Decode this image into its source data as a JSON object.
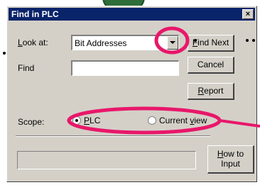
{
  "dialog": {
    "title": "Find in PLC",
    "close_glyph": "×"
  },
  "look_at": {
    "label_u": "L",
    "label_rest": "ook at:",
    "value": "Bit Addresses"
  },
  "find": {
    "label": "Find",
    "value": ""
  },
  "buttons": {
    "find_next_u": "F",
    "find_next_rest": "ind Next",
    "cancel": "Cancel",
    "report_u": "R",
    "report_rest": "eport",
    "how_to_line1_u": "H",
    "how_to_line1_rest": "ow to",
    "how_to_line2": "Input"
  },
  "scope": {
    "label": "Scope:",
    "options": [
      {
        "u": "P",
        "rest": "LC",
        "selected": true
      },
      {
        "pre": "Current ",
        "u": "v",
        "rest": "iew",
        "selected": false
      }
    ]
  },
  "annotations": {
    "highlight_color": "#e8176a",
    "arrow_color": "#2f6e3a"
  }
}
